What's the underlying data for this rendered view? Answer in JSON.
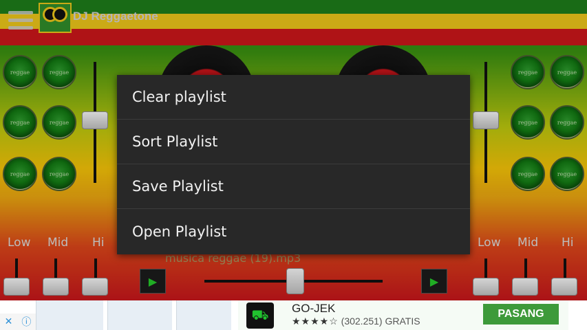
{
  "app": {
    "title": "DJ Reggaetone",
    "pad_label": "reggae",
    "colors": {
      "green": "#1d7a1a",
      "yellow": "#e8c21a",
      "red": "#c8161a",
      "menu_bg": "#282828"
    }
  },
  "eq": {
    "left": [
      "Low",
      "Mid",
      "Hi"
    ],
    "right": [
      "Low",
      "Mid",
      "Hi"
    ]
  },
  "player": {
    "play_icon": "▶",
    "track_text": "musica reggae (19).mp3"
  },
  "context_menu": {
    "items": [
      {
        "label": "Clear playlist"
      },
      {
        "label": "Sort Playlist"
      },
      {
        "label": "Save Playlist"
      },
      {
        "label": "Open Playlist"
      }
    ]
  },
  "ad": {
    "app_name": "GO-JEK",
    "stars": "★★★★☆",
    "rating_count": "(302.251)",
    "price": "GRATIS",
    "install_label": "PASANG",
    "close_icon": "✕",
    "info_icon": "ⓘ"
  }
}
